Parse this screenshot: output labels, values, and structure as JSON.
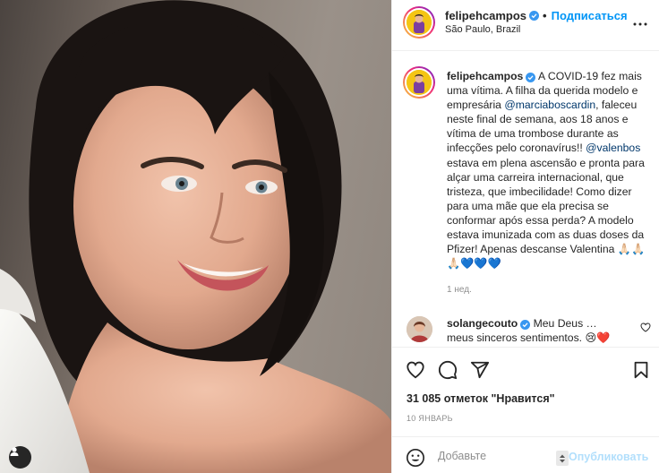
{
  "photo": {
    "alt_icon": "user-tag-icon"
  },
  "header": {
    "username": "felipehcampos",
    "separator": "•",
    "follow_label": "Подписаться",
    "location": "São Paulo, Brazil",
    "more_icon": "more-dots-icon"
  },
  "caption": {
    "username": "felipehcampos",
    "part1": " A COVID-19 fez mais uma vítima. A filha da querida modelo e empresária ",
    "mention1": "@marciaboscardin",
    "part2": ", faleceu neste final de semana, aos 18 anos e vítima de uma trombose durante as infecções pelo coronavírus!! ",
    "mention2": "@valenbos",
    "part3": " estava em plena ascensão e pronta para alçar uma carreira internacional, que tristeza, que imbecilidade! Como dizer para uma mãe que ela precisa se conformar após essa perda? A modelo estava imunizada com as duas doses da Pfizer! Apenas descanse Valentina 🙏🏻🙏🏻🙏🏻💙💙💙",
    "time": "1 нед."
  },
  "comment": {
    "username": "solangecouto",
    "text": " Meu Deus … meus sinceros sentimentos. 😢❤️"
  },
  "actions": {
    "likes": "31 085 отметок \"Нравится\"",
    "date": "10 ЯНВАРЬ"
  },
  "add_comment": {
    "placeholder": "Добавьте",
    "publish_label": "Опубликовать"
  },
  "colors": {
    "accent": "#0095f6",
    "verified": "#3897f0",
    "publish_disabled": "#b2dffc"
  }
}
